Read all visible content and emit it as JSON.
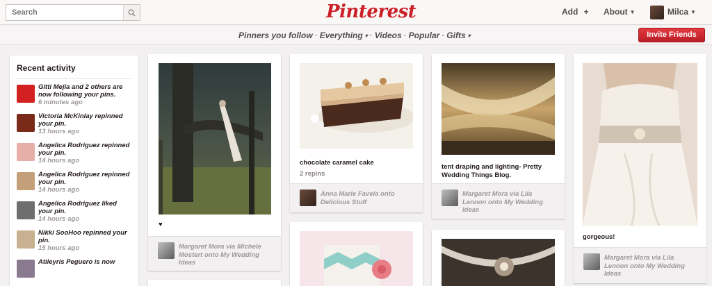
{
  "header": {
    "search_placeholder": "Search",
    "logo": "Pinterest",
    "add_label": "Add",
    "add_symbol": "+",
    "about_label": "About",
    "user_name": "Milca"
  },
  "subnav": {
    "links": [
      "Pinners you follow",
      "Everything",
      "Videos",
      "Popular",
      "Gifts"
    ],
    "invite_label": "Invite Friends"
  },
  "activity": {
    "title": "Recent activity",
    "items": [
      {
        "text": "Gitti Mejia and 2 others are now following your pins.",
        "time": "6 minutes ago",
        "thumb_color": "#d32020"
      },
      {
        "text": "Victoria McKinlay repinned your pin.",
        "time": "13 hours ago",
        "thumb_color": "#7a2a18"
      },
      {
        "text": "Angelica Rodriguez repinned your pin.",
        "time": "14 hours ago",
        "thumb_color": "#e6b0a8"
      },
      {
        "text": "Angelica Rodriguez repinned your pin.",
        "time": "14 hours ago",
        "thumb_color": "#c4a07a"
      },
      {
        "text": "Angelica Rodriguez liked your pin.",
        "time": "14 hours ago",
        "thumb_color": "#6e6e6e"
      },
      {
        "text": "Nikki SooHoo repinned your pin.",
        "time": "15 hours ago",
        "thumb_color": "#c8b090"
      },
      {
        "text": "Atileyris Peguero is now",
        "time": "",
        "thumb_color": "#8a7a90"
      }
    ]
  },
  "pins": [
    {
      "description": "♥",
      "stats": "",
      "foot_text": "Margaret Mora via Michele Mostert onto My Wedding Ideas"
    },
    {
      "description": "chocolate caramel cake",
      "stats": "2 repins",
      "foot_text": "Anna Marie Favela onto Delicious Stuff"
    },
    {
      "description": "tent draping and lighting- Pretty Wedding Things Blog.",
      "stats": "",
      "foot_text": "Margaret Mora via Lila Lennon onto My Wedding Ideas"
    },
    {
      "description": "gorgeous!",
      "stats": "",
      "foot_text": "Margaret Mora via Lila Lennon onto My Wedding Ideas"
    }
  ],
  "colors": {
    "brand": "#cb2027",
    "background": "#f2f0f0"
  }
}
